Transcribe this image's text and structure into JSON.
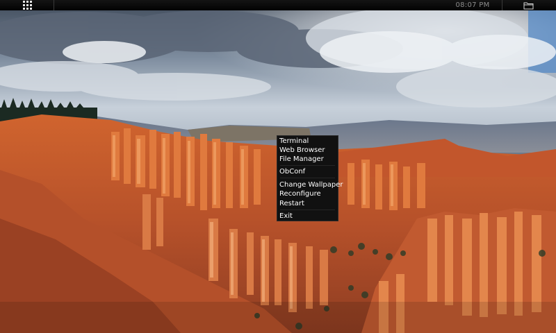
{
  "panel": {
    "apps_icon": "apps-grid-icon",
    "clock": "08:07 PM",
    "folder_icon": "folder-icon"
  },
  "menu": {
    "items": [
      "Terminal",
      "Web Browser",
      "File Manager",
      "ObConf",
      "Change Wallpaper",
      "Reconfigure",
      "Restart",
      "Exit"
    ]
  },
  "colors": {
    "panel": "#0a0a0a",
    "menu_bg": "#111111",
    "menu_text": "#ffffff",
    "clock_text": "#8c8c8c"
  }
}
